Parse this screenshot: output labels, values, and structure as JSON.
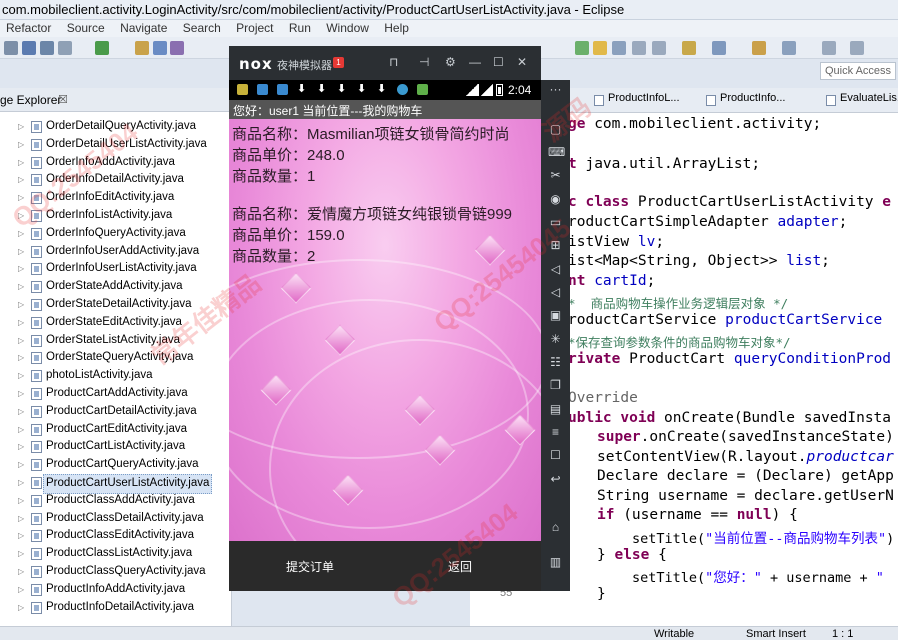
{
  "window": {
    "title": "com.mobileclient.activity.LoginActivity/src/com/mobileclient/activity/ProductCartUserListActivity.java - Eclipse"
  },
  "menu": [
    "Refactor",
    "Source",
    "Navigate",
    "Search",
    "Project",
    "Run",
    "Window",
    "Help"
  ],
  "quick_access": "Quick Access",
  "package_explorer": {
    "title": "ge Explorer",
    "close": "☒",
    "items": [
      "OrderDetailQueryActivity.java",
      "OrderDetailUserListActivity.java",
      "OrderInfoAddActivity.java",
      "OrderInfoDetailActivity.java",
      "OrderInfoEditActivity.java",
      "OrderInfoListActivity.java",
      "OrderInfoQueryActivity.java",
      "OrderInfoUserAddActivity.java",
      "OrderInfoUserListActivity.java",
      "OrderStateAddActivity.java",
      "OrderStateDetailActivity.java",
      "OrderStateEditActivity.java",
      "OrderStateListActivity.java",
      "OrderStateQueryActivity.java",
      "photoListActivity.java",
      "ProductCartAddActivity.java",
      "ProductCartDetailActivity.java",
      "ProductCartEditActivity.java",
      "ProductCartListActivity.java",
      "ProductCartQueryActivity.java",
      "ProductCartUserListActivity.java",
      "ProductClassAddActivity.java",
      "ProductClassDetailActivity.java",
      "ProductClassEditActivity.java",
      "ProductClassListActivity.java",
      "ProductClassQueryActivity.java",
      "ProductInfoAddActivity.java",
      "ProductInfoDetailActivity.java"
    ],
    "selected_index": 20
  },
  "editor": {
    "tabs": [
      "ProductInfoL...",
      "ProductInfo...",
      "EvaluateLis..."
    ],
    "line_number": "55"
  },
  "status": {
    "writable": "Writable",
    "insert": "Smart Insert",
    "position": "1 : 1"
  },
  "emulator": {
    "logo": "nox",
    "name": "夜神模拟器",
    "badge": "1",
    "controls": [
      "⊓",
      "⊣",
      "⚙",
      "—",
      "☐",
      "✕"
    ],
    "clock": "2:04",
    "app_title": "您好：user1  当前位置---我的购物车",
    "cart_items": [
      {
        "name": "商品名称：Masmilian项链女锁骨简约时尚",
        "price": "商品单价：248.0",
        "qty": "商品数量：1"
      },
      {
        "name": "商品名称：爱情魔方项链女纯银锁骨链999",
        "price": "商品单价：159.0",
        "qty": "商品数量：2"
      }
    ],
    "submit_button": "提交订单",
    "back_button": "返回",
    "rail_more": "···"
  },
  "watermarks": [
    "QQ:2545404",
    "常年佳精品",
    "QQ:25454045",
    "源码",
    "QQ:2545404"
  ],
  "colors": {
    "keyword": "#7f0055",
    "field": "#0000c0",
    "comment": "#3f7f5f",
    "string": "#2a00ff"
  }
}
